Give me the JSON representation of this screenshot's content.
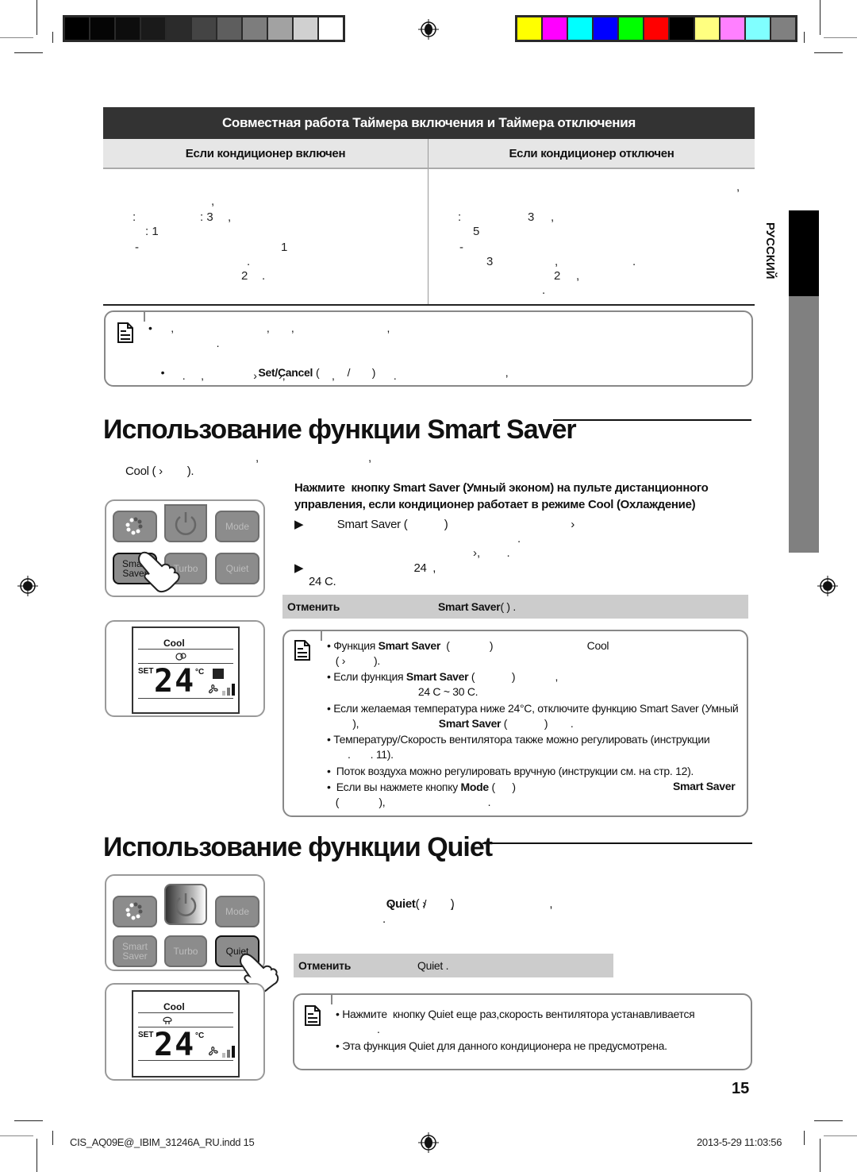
{
  "print_marks": {
    "grayscale_swatches": [
      "#000000",
      "#050505",
      "#0d0d0d",
      "#1a1a1a",
      "#2b2b2b",
      "#444444",
      "#5e5e5e",
      "#7d7d7d",
      "#a2a2a2",
      "#d0d0d0",
      "#ffffff"
    ],
    "color_swatches": [
      "#ffff00",
      "#ff00ff",
      "#00ffff",
      "#0000ff",
      "#00ff00",
      "#ff0000",
      "#000000",
      "#ffff80",
      "#ff80ff",
      "#80ffff",
      "#808080"
    ]
  },
  "timer_table": {
    "title": "Совместная работа Таймера включения и Таймера отключения",
    "col_on": "Если кондиционер включен",
    "col_off": "Если кондиционер отключен",
    "left_fragments": [
      ",",
      ":",
      ": 3",
      ",",
      ": 1",
      "-",
      "1",
      ".",
      "2",
      "."
    ],
    "right_fragments": [
      ",",
      ":",
      "3",
      ",",
      "5",
      "-",
      "3",
      ",",
      ".",
      "2",
      ",",
      "."
    ]
  },
  "timer_note": {
    "line1": "•      ,                              ,       ,                              ,",
    "line2": "                      .",
    "line3_prefix": "•",
    "line3_bold": "Set/Cancel",
    "line3_rest": " (         /       )                                          ,",
    "line4": "           .     ,                ›       ›,               ,                   ."
  },
  "smart_saver": {
    "heading": "Использование функции Smart Saver",
    "intro_fragments": [
      ",",
      ","
    ],
    "intro_line2": "Cool ( ›        ).",
    "instruction_line1": "Нажмите  кнопку Smart Saver (Умный эконом) на пульте дистанционного",
    "instruction_line2": "управления, если кондиционер работает в режиме Cool (Охлаждение)",
    "bullet1": "▶           Smart Saver (            )                                        ›",
    "bullet1_frag1": ".",
    "bullet1_frag2": "›,        .",
    "bullet2": "▶                                    24  ,",
    "bullet2_line2": "24 C.",
    "cancel_label": "Отменить",
    "cancel_bold": "Smart Saver",
    "cancel_rest": " (             )         .",
    "notes": [
      {
        "pre": "• Функция ",
        "bold": "Smart Saver",
        "post": "  (              )                                 Cool"
      },
      {
        "pre": "   ( ›          ).",
        "bold": "",
        "post": ""
      },
      {
        "pre": "• Если функция ",
        "bold": "Smart Saver",
        "post": " (             )              ,"
      },
      {
        "pre": "                                24 C ~ 30 C.",
        "bold": "",
        "post": ""
      },
      {
        "pre": "• Если желаемая температура ниже 24°C, отключите функцию Smart Saver (Умный",
        "bold": "",
        "post": ""
      },
      {
        "pre": "         ),                            ",
        "bold": "Smart Saver",
        "post": " (             )        ."
      },
      {
        "pre": "• Температуру/Скорость вентилятора также можно регулировать (инструкции",
        "bold": "",
        "post": ""
      },
      {
        "pre": "     .       . 11).",
        "bold": "",
        "post": ""
      },
      {
        "pre": "•  Поток воздуха можно регулировать вручную (инструкции см. на стр. 12).",
        "bold": "",
        "post": ""
      },
      {
        "pre": "•  Если вы нажмете кнопку ",
        "bold": "Mode",
        "post": " (      )"
      },
      {
        "pre": "   (              ),                                    .",
        "bold": "",
        "post": ""
      }
    ],
    "note_trailing_bold": "Smart Saver"
  },
  "quiet": {
    "heading": "Использование функции Quiet",
    "line1_bold": "Quiet",
    "line1_rest": "( ›        )                               ,",
    "line2": "›          /        ,",
    "line3": ".",
    "cancel_label": "Отменить",
    "cancel_rest": "Quiet       .",
    "notes": [
      "• Нажмите  кнопку Quiet еще раз,скорость вентилятора устанавливается",
      ".",
      "• Эта функция Quiet для данного кондиционера не предусмотрена."
    ]
  },
  "remote": {
    "buttons": {
      "mode": "Mode",
      "smart_saver": "Smart Saver",
      "turbo": "Turbo",
      "quiet": "Quiet"
    },
    "display": {
      "mode": "Cool",
      "set": "SET",
      "temperature": "24",
      "unit": "°C"
    }
  },
  "side_tab": {
    "label": "РУССКИЙ"
  },
  "page_number": "15",
  "footer": {
    "file": "CIS_AQ09E@_IBIM_31246A_RU.indd   15",
    "timestamp": "2013-5-29   11:03:56"
  }
}
